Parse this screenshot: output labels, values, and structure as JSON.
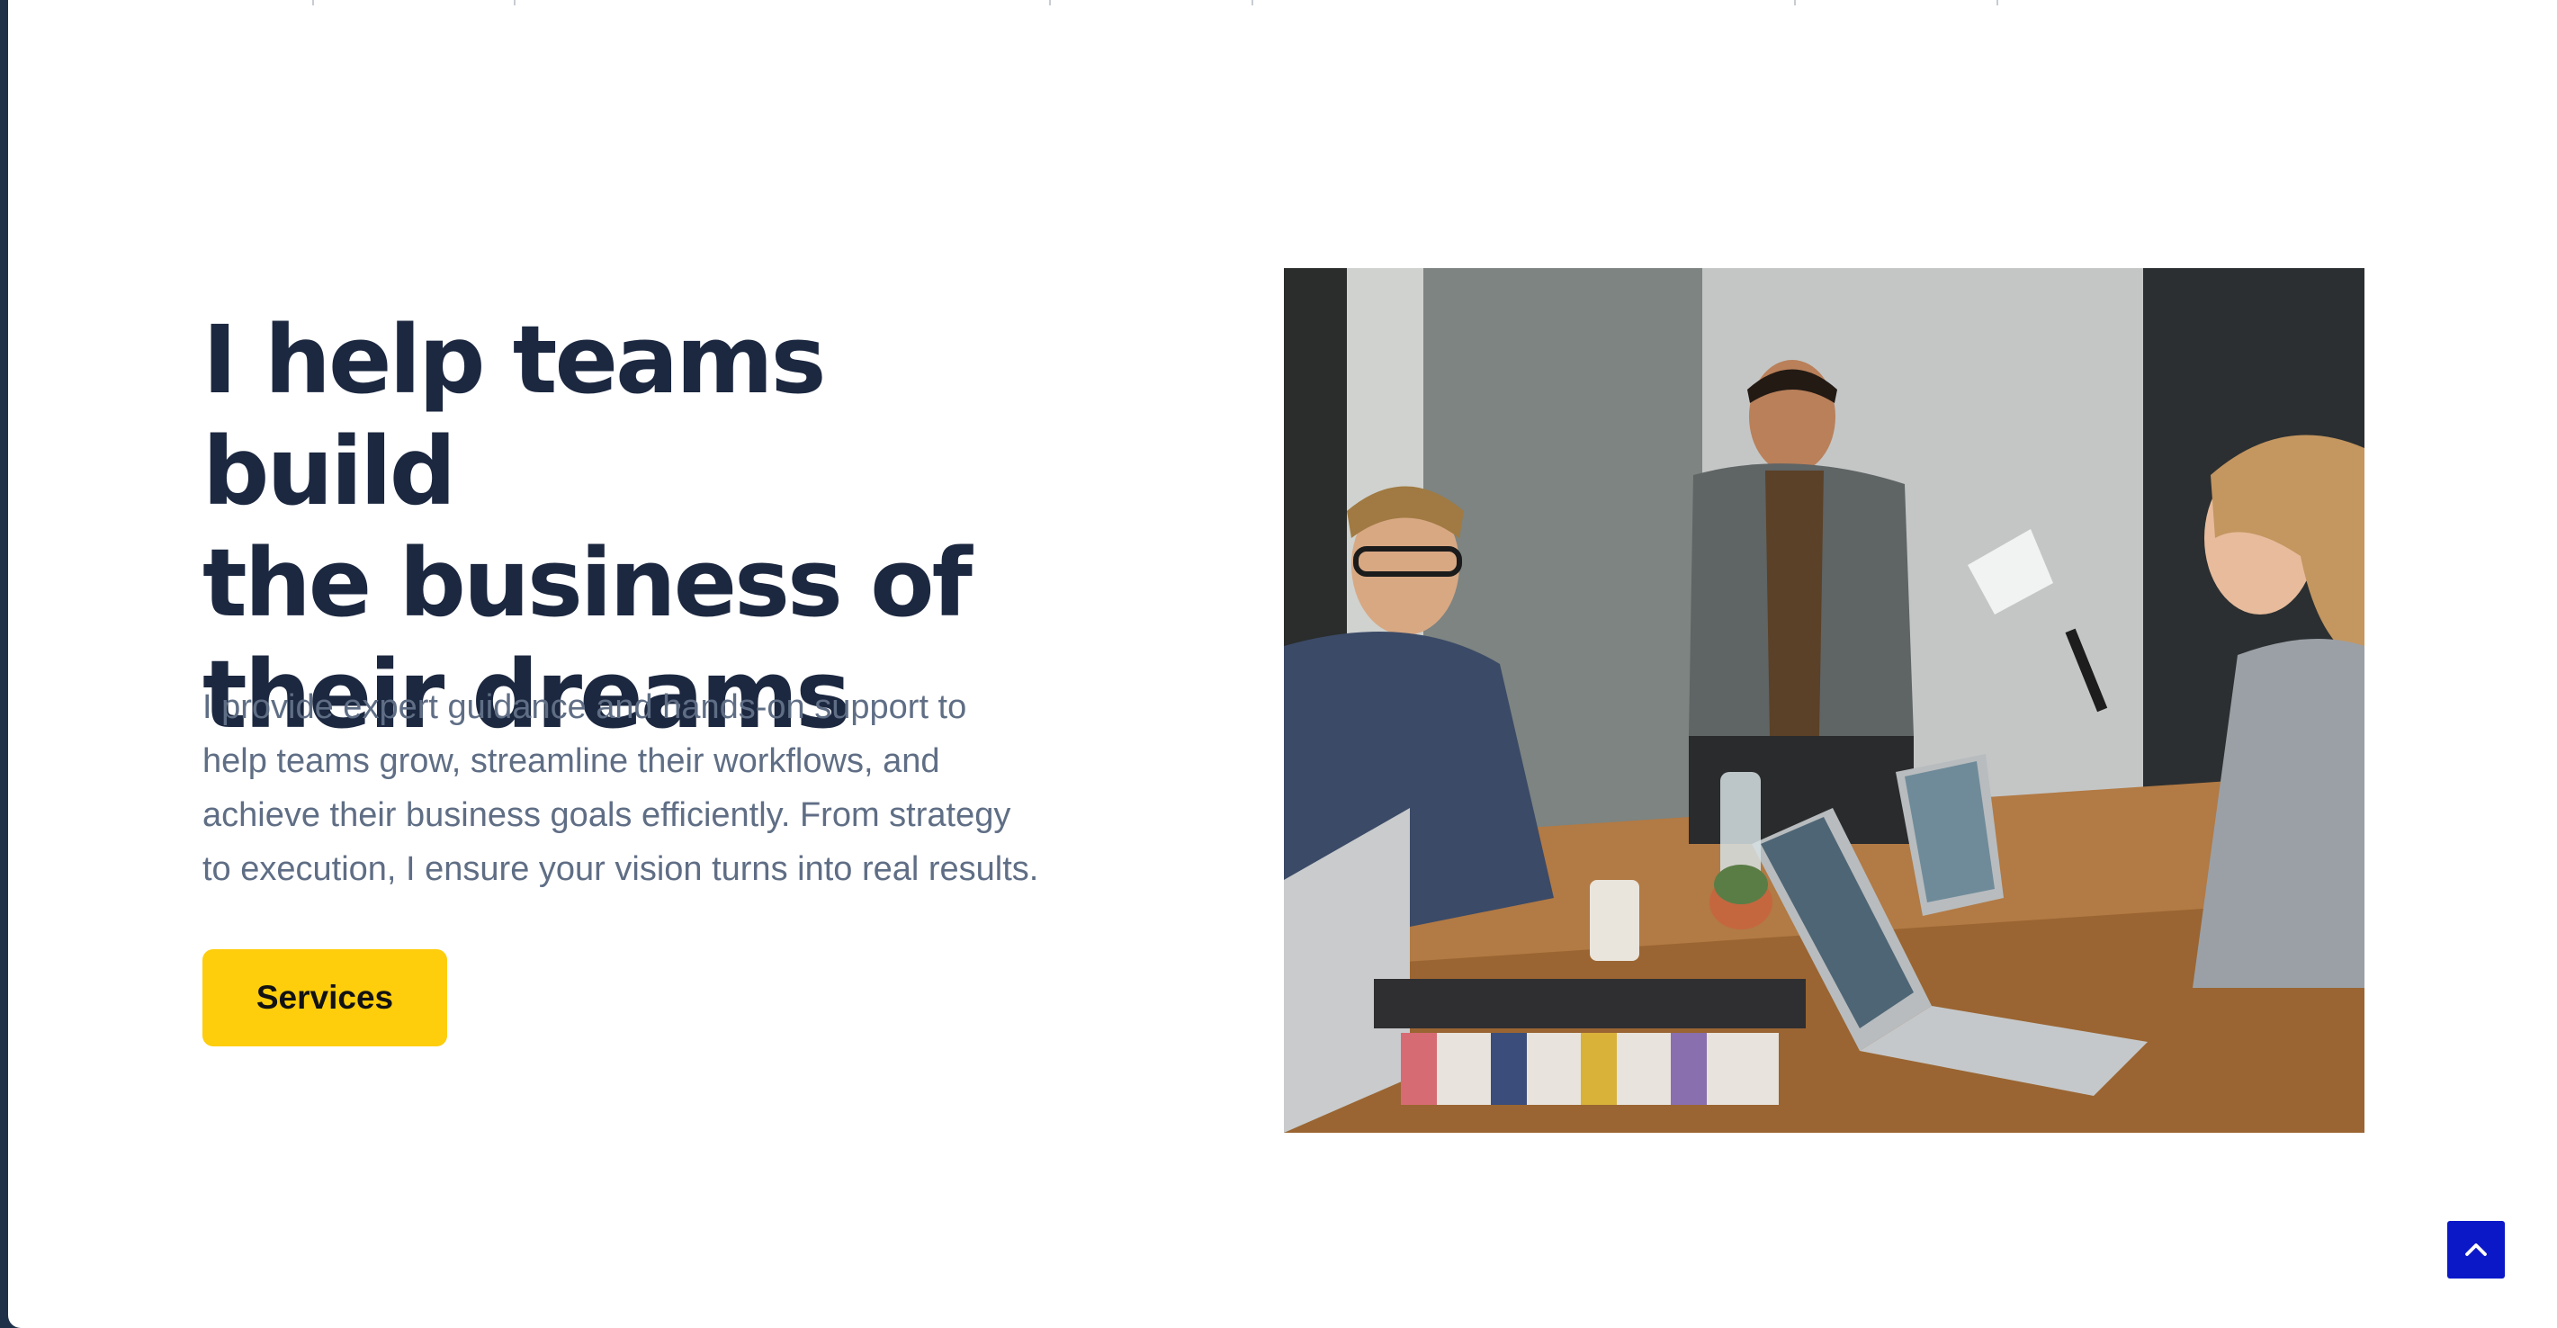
{
  "hero": {
    "headline": "I help teams build\nthe business of\ntheir dreams",
    "description": "I provide expert guidance and hands-on support to\nhelp teams grow, streamline their workflows, and\nachieve their business goals efficiently. From strategy\nto execution, I ensure your vision turns into real results.",
    "cta_label": "Services",
    "image_subject": "team meeting at conference table with laptops"
  },
  "icons": {
    "back_to_top": "chevron-up-icon"
  },
  "colors": {
    "page_frame": "#1f3149",
    "background": "#ffffff",
    "headline": "#1c2840",
    "body_text": "#5f6e85",
    "cta_background": "#fecd0c",
    "back_to_top_background": "#0b18c7"
  }
}
